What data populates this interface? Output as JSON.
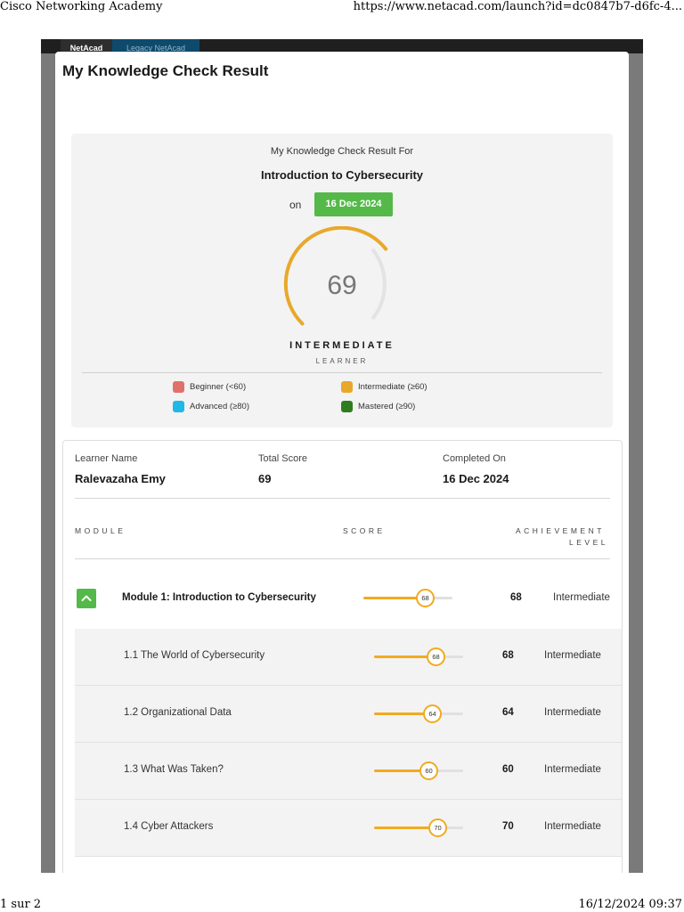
{
  "print": {
    "header_left": "Cisco Networking Academy",
    "header_right": "https://www.netacad.com/launch?id=dc0847b7-d6fc-4...",
    "footer_left": "1 sur 2",
    "footer_right": "16/12/2024 09:37"
  },
  "app": {
    "tabs": [
      {
        "label": "NetAcad"
      },
      {
        "label": "Legacy NetAcad"
      }
    ]
  },
  "modal": {
    "title": "My Knowledge Check Result"
  },
  "summary": {
    "subtitle": "My Knowledge Check Result For",
    "course": "Introduction to Cybersecurity",
    "on_label": "on",
    "date": "16 Dec 2024",
    "score": "69",
    "score_value": 69,
    "level": "INTERMEDIATE",
    "learner": "LEARNER",
    "legend": [
      {
        "label": "Beginner (<60)",
        "color": "#e0706a"
      },
      {
        "label": "Intermediate (≥60)",
        "color": "#e8a82a"
      },
      {
        "label": "Advanced (≥80)",
        "color": "#1fb8e8"
      },
      {
        "label": "Mastered (≥90)",
        "color": "#2f7d1f"
      }
    ]
  },
  "details": {
    "learner_label": "Learner Name",
    "learner_value": "Ralevazaha Emy",
    "total_label": "Total Score",
    "total_value": "69",
    "completed_label": "Completed On",
    "completed_value": "16 Dec 2024",
    "col_module": "MODULE",
    "col_score": "SCORE",
    "col_achievement_1": "ACHIEVEMENT",
    "col_achievement_2": "LEVEL"
  },
  "module": {
    "name": "Module 1: Introduction to Cybersecurity",
    "score": "68",
    "score_value": 68,
    "level": "Intermediate"
  },
  "submodules": [
    {
      "name": "1.1 The World of Cybersecurity",
      "score": "68",
      "score_value": 68,
      "level": "Intermediate"
    },
    {
      "name": "1.2 Organizational Data",
      "score": "64",
      "score_value": 64,
      "level": "Intermediate"
    },
    {
      "name": "1.3 What Was Taken?",
      "score": "60",
      "score_value": 60,
      "level": "Intermediate"
    },
    {
      "name": "1.4 Cyber Attackers",
      "score": "70",
      "score_value": 70,
      "level": "Intermediate"
    }
  ],
  "colors": {
    "accent_green": "#54b948",
    "intermediate_orange": "#f0ab1f"
  }
}
